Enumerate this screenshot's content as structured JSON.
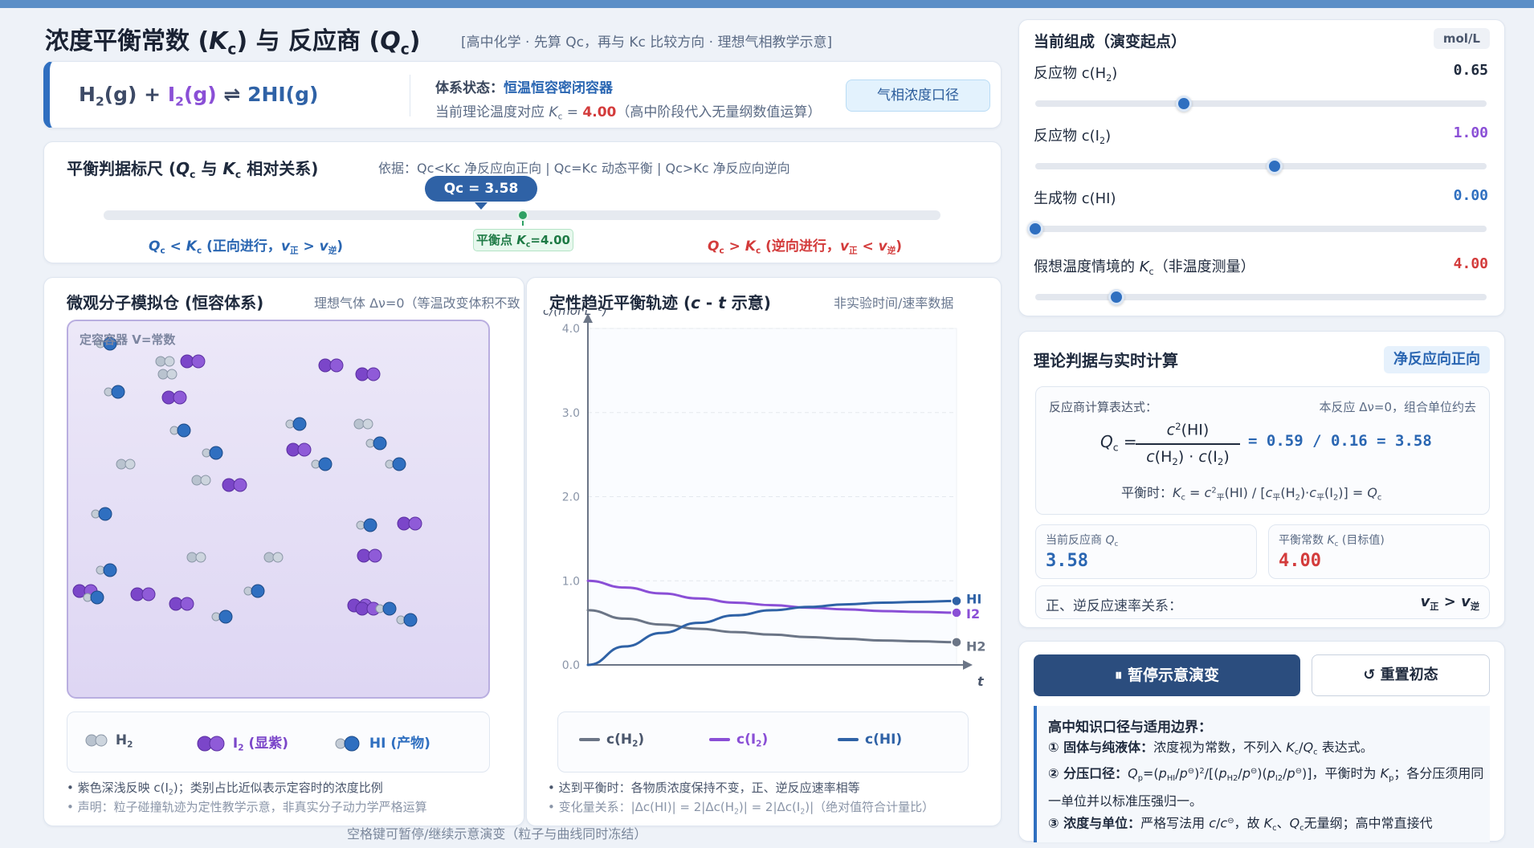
{
  "header": {
    "title": "浓度平衡常数 (Kc) 与 反应商 (Qc)",
    "subtitle": "[高中化学 · 先算 Qc，再与 Kc 比较方向 · 理想气相教学示意]"
  },
  "reaction": {
    "equation": "H2(g) + I2(g) ⇌ 2HI(g)",
    "system_label": "体系状态：",
    "system_value": "恒温恒容密闭容器",
    "temp_prefix": "当前理论温度对应 Kc = ",
    "temp_kc": "4.00",
    "temp_suffix": "（高中阶段代入无量纲数值运算）",
    "gas_badge": "气相浓度口径"
  },
  "scale": {
    "title": "平衡判据标尺 (Qc 与 Kc 相对关系)",
    "basis": "依据：Qc<Kc 净反应向正向 | Qc=Kc 动态平衡 | Qc>Kc 净反应向逆向",
    "qc_bubble": "Qc = 3.58",
    "eq_point": "平衡点 Kc=4.00",
    "forward": "Qc < Kc (正向进行，v正 > v逆)",
    "reverse": "Qc > Kc (逆向进行，v正 < v逆)"
  },
  "molecule_panel": {
    "title": "微观分子模拟仓 (恒容体系)",
    "note": "理想气体 Δν=0（等温改变体积不致",
    "box_label": "定容容器 V=常数",
    "legend": [
      {
        "label": "H2",
        "color": "#9aa8b8"
      },
      {
        "label": "I2 (显紫)",
        "color": "#7b46c9"
      },
      {
        "label": "HI (产物)",
        "color": "#2f6fc0"
      }
    ],
    "note1": "• 紫色深浅反映 c(I2)；类别占比近似表示定容时的浓度比例",
    "note2": "• 声明：粒子碰撞轨迹为定性教学示意，非真实分子动力学严格运算"
  },
  "chart_panel": {
    "title": "定性趋近平衡轨迹 (c - t 示意)",
    "note": "非实验时间/速率数据",
    "legend": [
      "c(H2)",
      "c(I2)",
      "c(HI)"
    ],
    "note1": "• 达到平衡时：各物质浓度保持不变，正、逆反应速率相等",
    "note2": "• 变化量关系：|Δc(HI)| = 2|Δc(H2)| = 2|Δc(I2)|（绝对值符合计量比）"
  },
  "chart_data": {
    "type": "line",
    "title": "定性趋近平衡轨迹 (c - t 示意)",
    "xlabel": "t",
    "ylabel": "c/(mol·L⁻¹)",
    "ylim": [
      0,
      4.0
    ],
    "xlim": [
      0,
      1
    ],
    "y_ticks": [
      "0.0",
      "1.0",
      "2.0",
      "3.0",
      "4.0"
    ],
    "grid": true,
    "x": [
      0,
      0.1,
      0.2,
      0.3,
      0.4,
      0.5,
      0.6,
      0.7,
      0.8,
      0.9,
      1.0
    ],
    "series": [
      {
        "name": "H2",
        "color": "#6b7586",
        "values": [
          0.65,
          0.55,
          0.48,
          0.43,
          0.39,
          0.36,
          0.33,
          0.31,
          0.29,
          0.28,
          0.27
        ]
      },
      {
        "name": "I2",
        "color": "#8a4fd6",
        "values": [
          1.0,
          0.92,
          0.85,
          0.79,
          0.74,
          0.71,
          0.68,
          0.66,
          0.64,
          0.63,
          0.62
        ]
      },
      {
        "name": "HI",
        "color": "#2f62a6",
        "values": [
          0.0,
          0.22,
          0.38,
          0.5,
          0.59,
          0.65,
          0.69,
          0.72,
          0.74,
          0.75,
          0.76
        ]
      }
    ]
  },
  "footer_hint": "空格键可暂停/继续示意演变（粒子与曲线同时冻结）",
  "composition": {
    "title": "当前组成（演变起点）",
    "unit": "mol/L",
    "sliders": [
      {
        "label": "反应物 c(H2)",
        "value": "0.65",
        "color": "#1f2a3d",
        "fraction": 0.33
      },
      {
        "label": "反应物 c(I2)",
        "value": "1.00",
        "color": "#8a4fd6",
        "fraction": 0.53
      },
      {
        "label": "生成物 c(HI)",
        "value": "0.00",
        "color": "#2f6fc0",
        "fraction": 0.0
      },
      {
        "label": "假想温度情境的 Kc（非温度测量）",
        "value": "4.00",
        "color": "#d33b3b",
        "fraction": 0.18
      }
    ]
  },
  "calc": {
    "title": "理论判据与实时计算",
    "direction_badge": "净反应向正向",
    "fx_label": "反应商计算表达式：",
    "fx_note": "本反应 Δν=0，组合单位约去",
    "fx_lhs": "Qc =",
    "fx_num": "c²(HI)",
    "fx_den": "c(H2) · c(I2)",
    "fx_value": "= 0.59 / 0.16 = 3.58",
    "fx_eq": "平衡时：Kc = c²平(HI) / [c平(H2)·c平(I2)] = Qc",
    "qc_label": "当前反应商 Qc",
    "qc_value": "3.58",
    "kc_label": "平衡常数 Kc (目标值)",
    "kc_value": "4.00",
    "rate_label": "正、逆反应速率关系：",
    "rate_value": "v正 > v逆"
  },
  "controls": {
    "pause_label": "⏸ 暂停示意演变",
    "reset_label": "↺ 重置初态"
  },
  "knowledge": {
    "title": "高中知识口径与适用边界：",
    "item1_head": "① 固体与纯液体：",
    "item1_body": "浓度视为常数，不列入 Kc/Qc 表达式。",
    "item2_head": "② 分压口径：",
    "item2_body": "Qp=(pHI/p⊖)²/[(pH2/p⊖)(pI2/p⊖)]，平衡时为 Kp；各分压须用同一单位并以标准压强归一。",
    "item3_head": "③ 浓度与单位：",
    "item3_body": "严格写法用 c/c⊖，故 Kc、Qc无量纲；高中常直接代"
  },
  "colors": {
    "accent": "#2f6fc0",
    "forward": "#2a66b2",
    "reverse": "#d33b3b",
    "equilibrium": "#2ea063",
    "h2": "#9aa8b8",
    "i2": "#7b46c9",
    "hi": "#2f6fc0"
  }
}
